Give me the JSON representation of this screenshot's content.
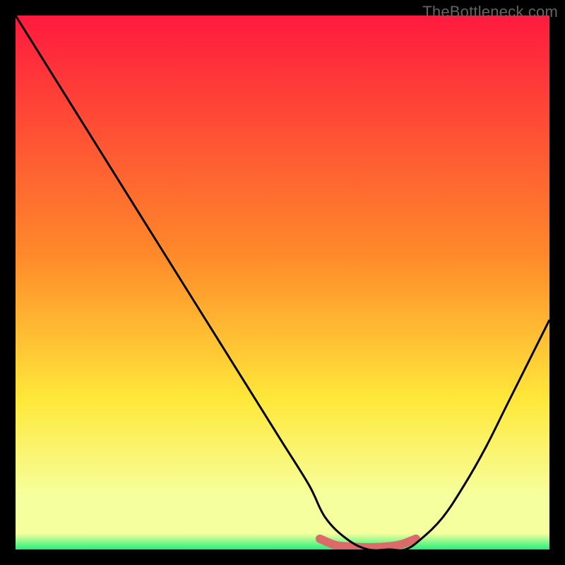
{
  "watermark": "TheBottleneck.com",
  "colors": {
    "frame": "#000000",
    "grad_top": "#ff1a3e",
    "grad_mid1": "#ff8a2a",
    "grad_mid2": "#ffe83a",
    "grad_low": "#f6ff9e",
    "grad_green": "#23f07a",
    "curve": "#000000",
    "ridge": "#dd6a6a"
  },
  "chart_data": {
    "type": "line",
    "title": "",
    "xlabel": "",
    "ylabel": "",
    "xlim": [
      0,
      100
    ],
    "ylim": [
      0,
      100
    ],
    "series": [
      {
        "name": "bottleneck-curve",
        "x": [
          0,
          5,
          10,
          15,
          20,
          25,
          30,
          35,
          40,
          45,
          50,
          55,
          58,
          62,
          66,
          70,
          73,
          76,
          80,
          84,
          88,
          92,
          96,
          100
        ],
        "y": [
          100,
          92,
          84,
          76,
          68,
          60,
          52,
          44,
          36,
          28,
          20,
          12,
          6,
          2,
          0,
          0,
          0,
          2,
          6,
          12,
          19,
          27,
          35,
          43
        ]
      },
      {
        "name": "bottom-ridge",
        "x": [
          57,
          60,
          63,
          66,
          69,
          72,
          75
        ],
        "y": [
          2,
          0.8,
          0.5,
          0.4,
          0.5,
          0.9,
          2
        ]
      }
    ],
    "gradient_stops": [
      {
        "pos": 0.0,
        "note": "top (red)"
      },
      {
        "pos": 0.45,
        "note": "orange"
      },
      {
        "pos": 0.72,
        "note": "yellow"
      },
      {
        "pos": 0.9,
        "note": "pale-yellow"
      },
      {
        "pos": 1.0,
        "note": "green"
      }
    ]
  }
}
